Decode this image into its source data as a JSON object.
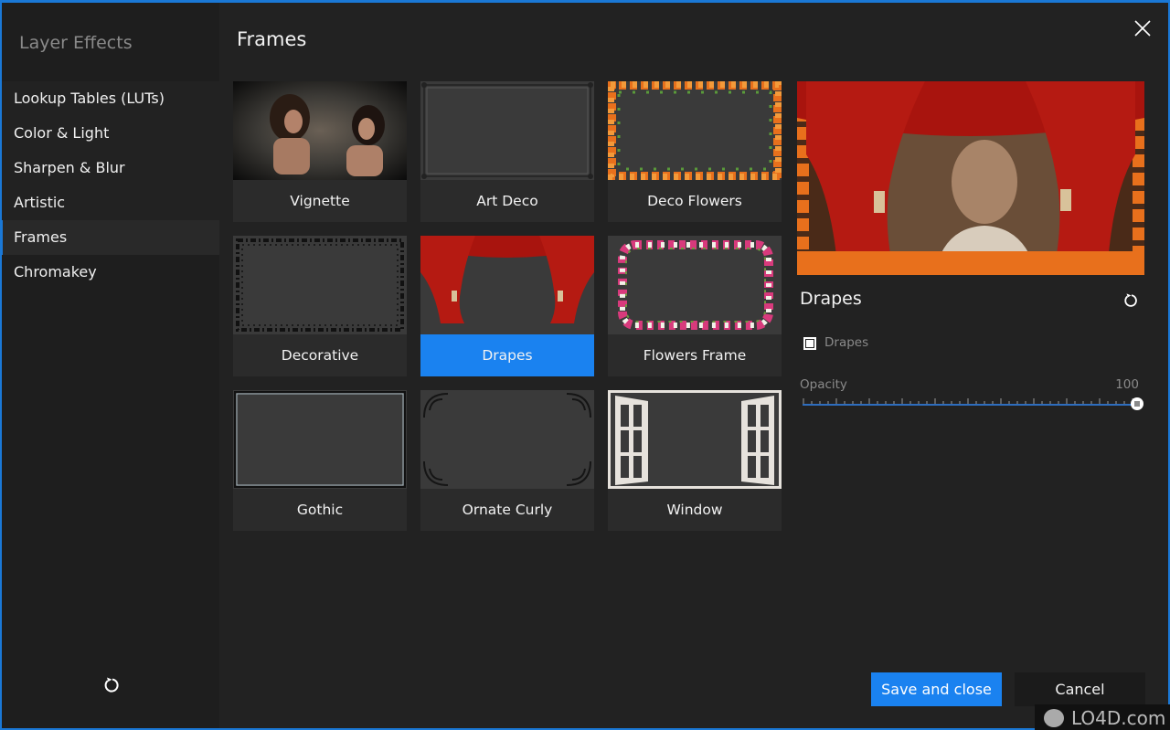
{
  "sidebar": {
    "title": "Layer Effects",
    "items": [
      {
        "label": "Lookup Tables (LUTs)",
        "active": false
      },
      {
        "label": "Color & Light",
        "active": false
      },
      {
        "label": "Sharpen & Blur",
        "active": false
      },
      {
        "label": "Artistic",
        "active": false
      },
      {
        "label": "Frames",
        "active": true
      },
      {
        "label": "Chromakey",
        "active": false
      }
    ],
    "reset_icon": "reset-icon"
  },
  "main": {
    "title": "Frames",
    "close_icon": "close-icon",
    "frames": [
      {
        "label": "Vignette",
        "selected": false
      },
      {
        "label": "Art Deco",
        "selected": false
      },
      {
        "label": "Deco Flowers",
        "selected": false
      },
      {
        "label": "Decorative",
        "selected": false
      },
      {
        "label": "Drapes",
        "selected": true
      },
      {
        "label": "Flowers Frame",
        "selected": false
      },
      {
        "label": "Gothic",
        "selected": false
      },
      {
        "label": "Ornate Curly",
        "selected": false
      },
      {
        "label": "Window",
        "selected": false
      }
    ]
  },
  "panel": {
    "effect_title": "Drapes",
    "checkbox_label": "Drapes",
    "checkbox_checked": true,
    "opacity_label": "Opacity",
    "opacity_value": "100",
    "opacity_percent": 100
  },
  "footer": {
    "save_label": "Save and close",
    "cancel_label": "Cancel"
  },
  "watermark": {
    "text": "LO4D.com"
  },
  "colors": {
    "accent": "#1a82f0",
    "window_border": "#1a78d6",
    "background": "#222222",
    "tile": "#2b2b2b"
  }
}
